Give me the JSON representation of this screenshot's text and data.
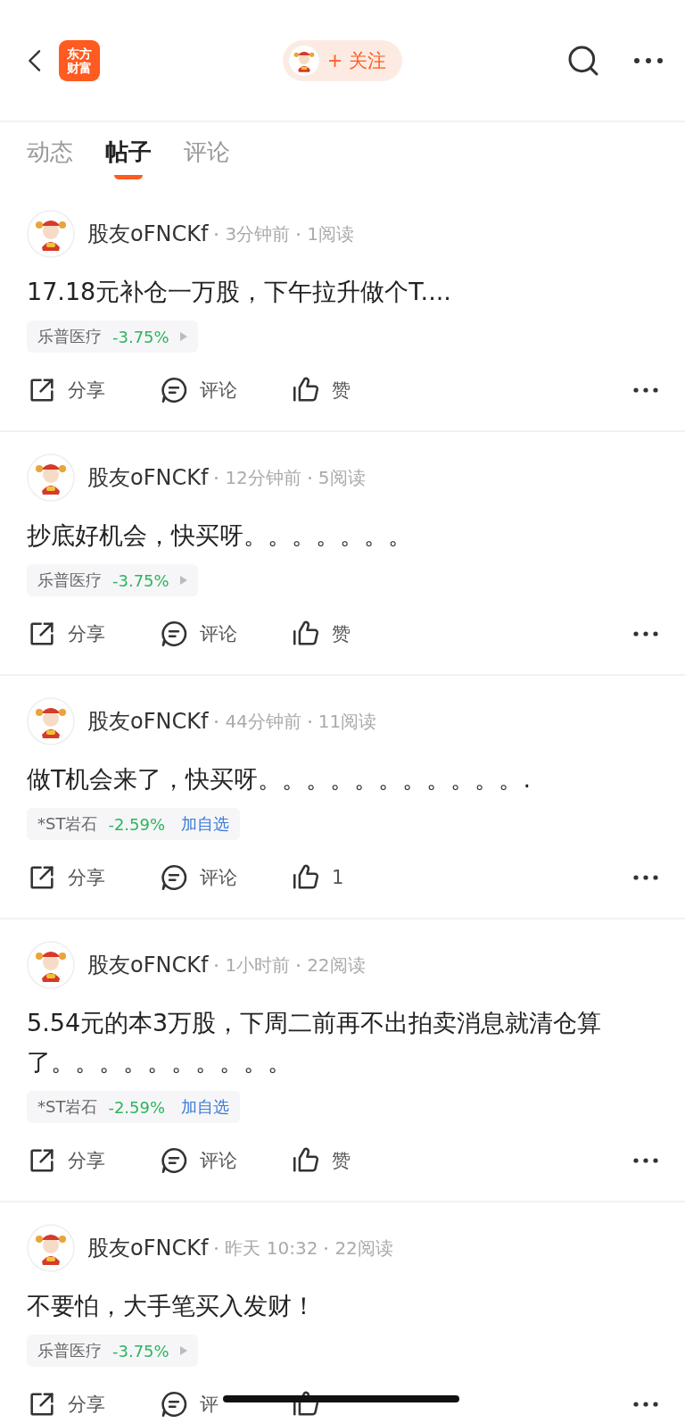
{
  "header": {
    "logo": [
      "东方",
      "财富"
    ],
    "follow": "+ 关注"
  },
  "tabs": [
    {
      "label": "动态",
      "selected": false
    },
    {
      "label": "帖子",
      "selected": true
    },
    {
      "label": "评论",
      "selected": false
    }
  ],
  "posts": [
    {
      "author": "股友oFNCKf",
      "time": "3分钟前",
      "reads": "1阅读",
      "text": "17.18元补仓一万股，下午拉升做个T....",
      "stock": {
        "name": "乐普医疗",
        "change": "-3.75%"
      },
      "actions": {
        "share": "分享",
        "comment": "评论",
        "like": "赞"
      }
    },
    {
      "author": "股友oFNCKf",
      "time": "12分钟前",
      "reads": "5阅读",
      "text": "抄底好机会，快买呀。。。。。。。",
      "stock": {
        "name": "乐普医疗",
        "change": "-3.75%"
      },
      "actions": {
        "share": "分享",
        "comment": "评论",
        "like": "赞"
      }
    },
    {
      "author": "股友oFNCKf",
      "time": "44分钟前",
      "reads": "11阅读",
      "text": "做T机会来了，快买呀。。。。。。。。。。。.",
      "stock": {
        "name": "*ST岩石",
        "change": "-2.59%",
        "action": "加自选"
      },
      "actions": {
        "share": "分享",
        "comment": "评论",
        "like": "1"
      }
    },
    {
      "author": "股友oFNCKf",
      "time": "1小时前",
      "reads": "22阅读",
      "text": "5.54元的本3万股，下周二前再不出拍卖消息就清仓算了。。。。。。。。。。",
      "stock": {
        "name": "*ST岩石",
        "change": "-2.59%",
        "action": "加自选"
      },
      "actions": {
        "share": "分享",
        "comment": "评论",
        "like": "赞"
      }
    },
    {
      "author": "股友oFNCKf",
      "time": "昨天 10:32",
      "reads": "22阅读",
      "text": "不要怕，大手笔买入发财！",
      "stock": {
        "name": "乐普医疗",
        "change": "-3.75%"
      },
      "actions": {
        "share": "分享",
        "comment": "评"
      }
    }
  ]
}
